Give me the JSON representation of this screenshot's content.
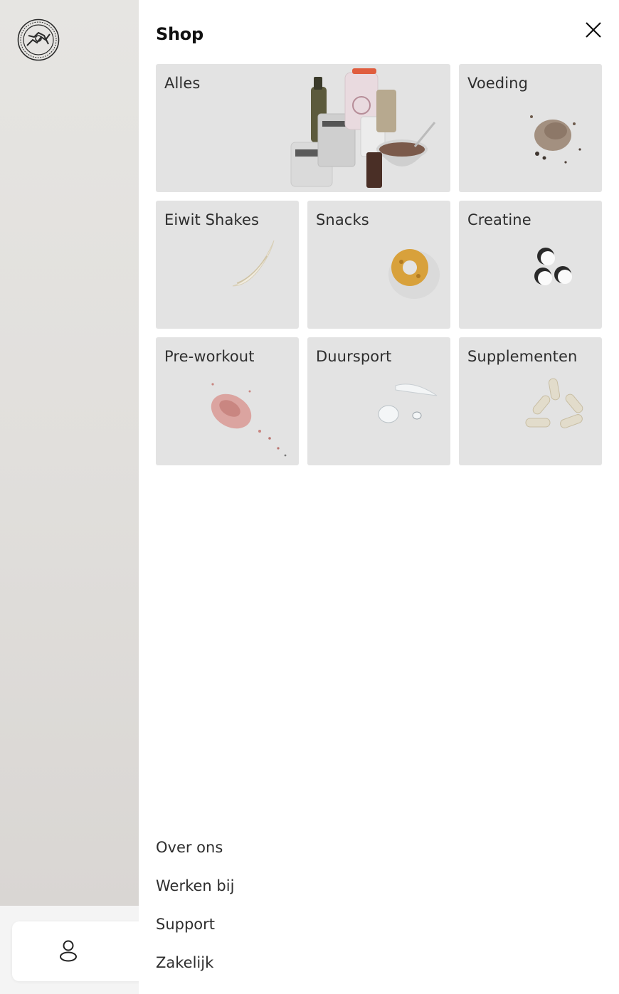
{
  "drawer": {
    "title": "Shop"
  },
  "categories": [
    {
      "label": "Alles",
      "image": "product-collage"
    },
    {
      "label": "Voeding",
      "image": "brown-powder-pile"
    },
    {
      "label": "Eiwit Shakes",
      "image": "white-powder-streak"
    },
    {
      "label": "Snacks",
      "image": "cereal-ring"
    },
    {
      "label": "Creatine",
      "image": "white-tablets"
    },
    {
      "label": "Pre-workout",
      "image": "pink-powder-pile"
    },
    {
      "label": "Duursport",
      "image": "clear-gel-drops"
    },
    {
      "label": "Supplementen",
      "image": "capsules"
    }
  ],
  "footer_links": [
    {
      "label": "Over ons"
    },
    {
      "label": "Werken bij"
    },
    {
      "label": "Support"
    },
    {
      "label": "Zakelijk"
    }
  ],
  "icons": {
    "close": "close-icon",
    "user": "user-icon",
    "logo": "brand-logo-icon"
  },
  "colors": {
    "tile_bg": "#e3e3e3",
    "text": "#2e2e2e",
    "title": "#111111",
    "backdrop": "#e1dfdc"
  }
}
